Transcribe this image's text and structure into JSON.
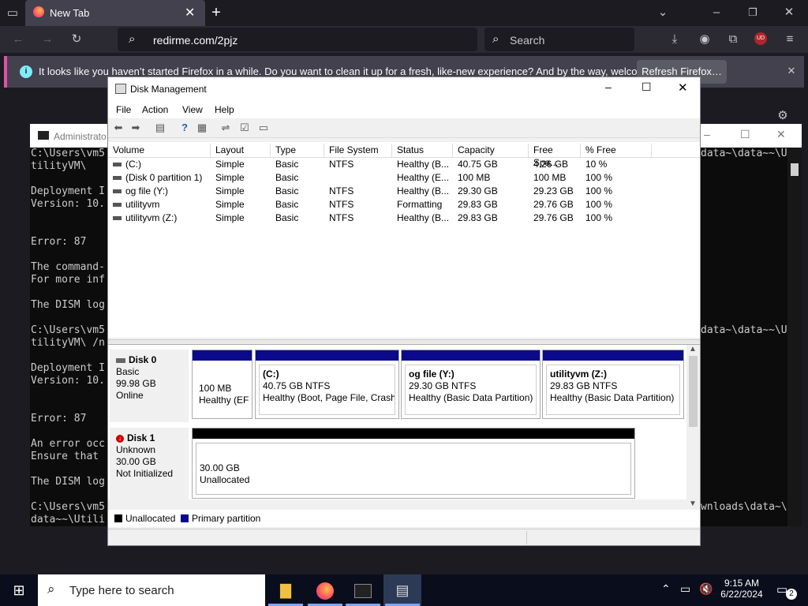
{
  "browser": {
    "tab_title": "New Tab",
    "url": "redirme.com/2pjz",
    "search_placeholder": "Search",
    "notification_text": "It looks like you haven’t started Firefox in a while. Do you want to clean it up for a fresh, like-new experience? And by the way, welcome back!",
    "refresh_button": "Refresh Firefox…",
    "profile_badge": "UD"
  },
  "terminal": {
    "title": "Administrato",
    "left_lines": [
      "C:\\Users\\vm5",
      "tilityVM\\",
      "",
      "Deployment I",
      "Version: 10.",
      "",
      "",
      "Error: 87",
      "",
      "The command-",
      "For more inf",
      "",
      "The DISM log",
      "",
      "C:\\Users\\vm5",
      "tilityVM\\ /n",
      "",
      "Deployment I",
      "Version: 10.",
      "",
      "",
      "Error: 87",
      "",
      "An error occ",
      "Ensure that",
      "",
      "The DISM log",
      "",
      "C:\\Users\\vm5",
      "data~~\\Utili"
    ],
    "right_line_1": "data~\\data~~\\U",
    "right_line_2": "data~\\data~~\\U",
    "right_line_3": "wnloads\\data~\\"
  },
  "disk_management": {
    "title": "Disk Management",
    "menu": {
      "file": "File",
      "action": "Action",
      "view": "View",
      "help": "Help"
    },
    "columns": {
      "volume": "Volume",
      "layout": "Layout",
      "type": "Type",
      "fs": "File System",
      "status": "Status",
      "capacity": "Capacity",
      "free": "Free Spa...",
      "pct": "% Free"
    },
    "volumes": [
      {
        "volume": "(C:)",
        "layout": "Simple",
        "type": "Basic",
        "fs": "NTFS",
        "status": "Healthy (B...",
        "capacity": "40.75 GB",
        "free": "4.26 GB",
        "pct": "10 %"
      },
      {
        "volume": "(Disk 0 partition 1)",
        "layout": "Simple",
        "type": "Basic",
        "fs": "",
        "status": "Healthy (E...",
        "capacity": "100 MB",
        "free": "100 MB",
        "pct": "100 %"
      },
      {
        "volume": "og file (Y:)",
        "layout": "Simple",
        "type": "Basic",
        "fs": "NTFS",
        "status": "Healthy (B...",
        "capacity": "29.30 GB",
        "free": "29.23 GB",
        "pct": "100 %"
      },
      {
        "volume": "utilityvm",
        "layout": "Simple",
        "type": "Basic",
        "fs": "NTFS",
        "status": "Formatting",
        "capacity": "29.83 GB",
        "free": "29.76 GB",
        "pct": "100 %"
      },
      {
        "volume": "utilityvm (Z:)",
        "layout": "Simple",
        "type": "Basic",
        "fs": "NTFS",
        "status": "Healthy (B...",
        "capacity": "29.83 GB",
        "free": "29.76 GB",
        "pct": "100 %"
      }
    ],
    "disk0": {
      "name": "Disk 0",
      "kind": "Basic",
      "size": "99.98 GB",
      "state": "Online",
      "p1": {
        "size": "100 MB",
        "status": "Healthy (EFI"
      },
      "p2": {
        "name": "(C:)",
        "size": "40.75 GB NTFS",
        "status": "Healthy (Boot, Page File, Crash D"
      },
      "p3": {
        "name": "og file  (Y:)",
        "size": "29.30 GB NTFS",
        "status": "Healthy (Basic Data Partition)"
      },
      "p4": {
        "name": "utilityvm  (Z:)",
        "size": "29.83 GB NTFS",
        "status": "Healthy (Basic Data Partition)"
      }
    },
    "disk1": {
      "name": "Disk 1",
      "kind": "Unknown",
      "size": "30.00 GB",
      "state": "Not Initialized",
      "p1": {
        "size": "30.00 GB",
        "status": "Unallocated"
      }
    },
    "legend": {
      "unallocated": "Unallocated",
      "primary": "Primary partition"
    }
  },
  "taskbar": {
    "search_placeholder": "Type here to search",
    "time": "9:15 AM",
    "date": "6/22/2024",
    "notification_count": "2"
  },
  "colors": {
    "primary_partition": "#0a0a8a",
    "unallocated": "#000000",
    "firefox_accent": "#e052a7"
  }
}
